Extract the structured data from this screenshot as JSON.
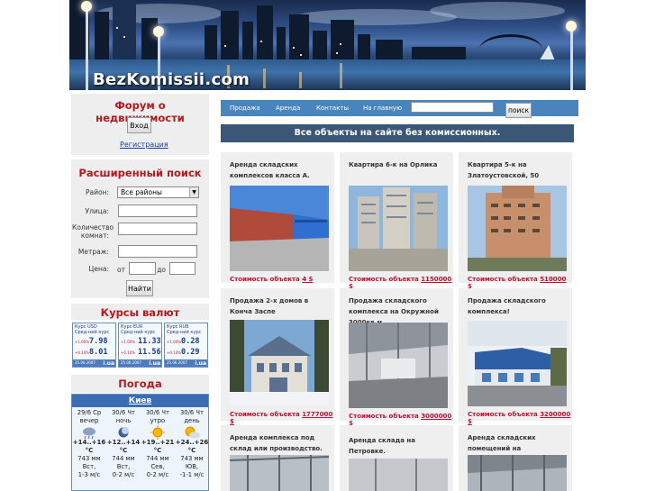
{
  "header": {
    "logo": "BezKomissii.com"
  },
  "sidebar": {
    "forum": {
      "title": "Форум о недвижимости",
      "login_button": "Вход",
      "register_link": "Регистрация"
    },
    "search": {
      "title": "Расширенный поиск",
      "district_label": "Район:",
      "district_value": "Все районы",
      "street_label": "Улица:",
      "rooms_label_1": "Количество",
      "rooms_label_2": "комнат:",
      "area_label": "Метраж:",
      "price_label": "Цена:",
      "from_label": "от",
      "to_label": "до",
      "submit": "Найти"
    },
    "currency": {
      "title": "Курсы валют",
      "widgets": [
        {
          "pair": "Курс USD",
          "sub": "Сред-ний курс",
          "buy": "7.98",
          "sell": "8.01",
          "buy_lbl": "+1.00%",
          "sell_lbl": "+0.10%",
          "date": "25.06.2007"
        },
        {
          "pair": "Курс EUR",
          "sub": "Сред-ний курс",
          "buy": "11.33",
          "sell": "11.56",
          "buy_lbl": "+1.00%",
          "sell_lbl": "+0.10%",
          "date": "25.06.2007"
        },
        {
          "pair": "Курс RUB",
          "sub": "Сред-ний курс",
          "buy": "0.28",
          "sell": "0.29",
          "buy_lbl": "+1.00%",
          "sell_lbl": "+0.10%",
          "date": "25.06.2007"
        }
      ],
      "brand": "i.ua"
    },
    "weather": {
      "title": "Погода",
      "city": "Киев",
      "days": [
        {
          "date": "29/6 Ср",
          "period": "вечер",
          "temp": "+14..+16 °С",
          "pressure": "743 мм",
          "wind_dir": "Вст,",
          "wind": "1-3 м/с"
        },
        {
          "date": "30/6 Чт",
          "period": "ночь",
          "temp": "+12..+14 °С",
          "pressure": "744 мм",
          "wind_dir": "Вст,",
          "wind": "0-2 м/с"
        },
        {
          "date": "30/6 Чт",
          "period": "утро",
          "temp": "+19..+21 °С",
          "pressure": "744 мм",
          "wind_dir": "Сев,",
          "wind": "0-2 м/с"
        },
        {
          "date": "30/6 Чт",
          "period": "день",
          "temp": "+24..+26 °С",
          "pressure": "743 мм",
          "wind_dir": "ЮВ,",
          "wind": "-1-1 м/с"
        }
      ]
    }
  },
  "nav": {
    "items": [
      "Продажа",
      "Аренда",
      "Контакты",
      "На главную"
    ],
    "search_button": "поиск"
  },
  "banner": "Все объекты на сайте без комиссионных.",
  "listings": [
    {
      "title": "Аренда складских комплексов класса А.",
      "price_label": "Стоимость объекта",
      "price": "4 $"
    },
    {
      "title": "Квартира 6-к на Орлика",
      "price_label": "Стоимость объекта",
      "price": "1150000 $"
    },
    {
      "title": "Квартира 5-к на Златоустовской, 50",
      "price_label": "Стоимость объекта",
      "price": "510000 $"
    },
    {
      "title": "Продажа 2-х домов в Конча Заспе",
      "price_label": "Стоимость объекта",
      "price": "1777000 $"
    },
    {
      "title": "Продажа складского комплекса на Окружной 3000кв.м.",
      "price_label": "Стоимость объекта",
      "price": "3000000 $"
    },
    {
      "title": "Продажа складского комплекса!",
      "price_label": "Стоимость объекта",
      "price": "3200000 $"
    },
    {
      "title": "Аренда комплекса под склад или производство.",
      "price_label": "",
      "price": ""
    },
    {
      "title": "Аренда склада на Петровке.",
      "price_label": "",
      "price": ""
    },
    {
      "title": "Аренда складских помещений на м.Лыбидская.",
      "price_label": "",
      "price": ""
    }
  ]
}
